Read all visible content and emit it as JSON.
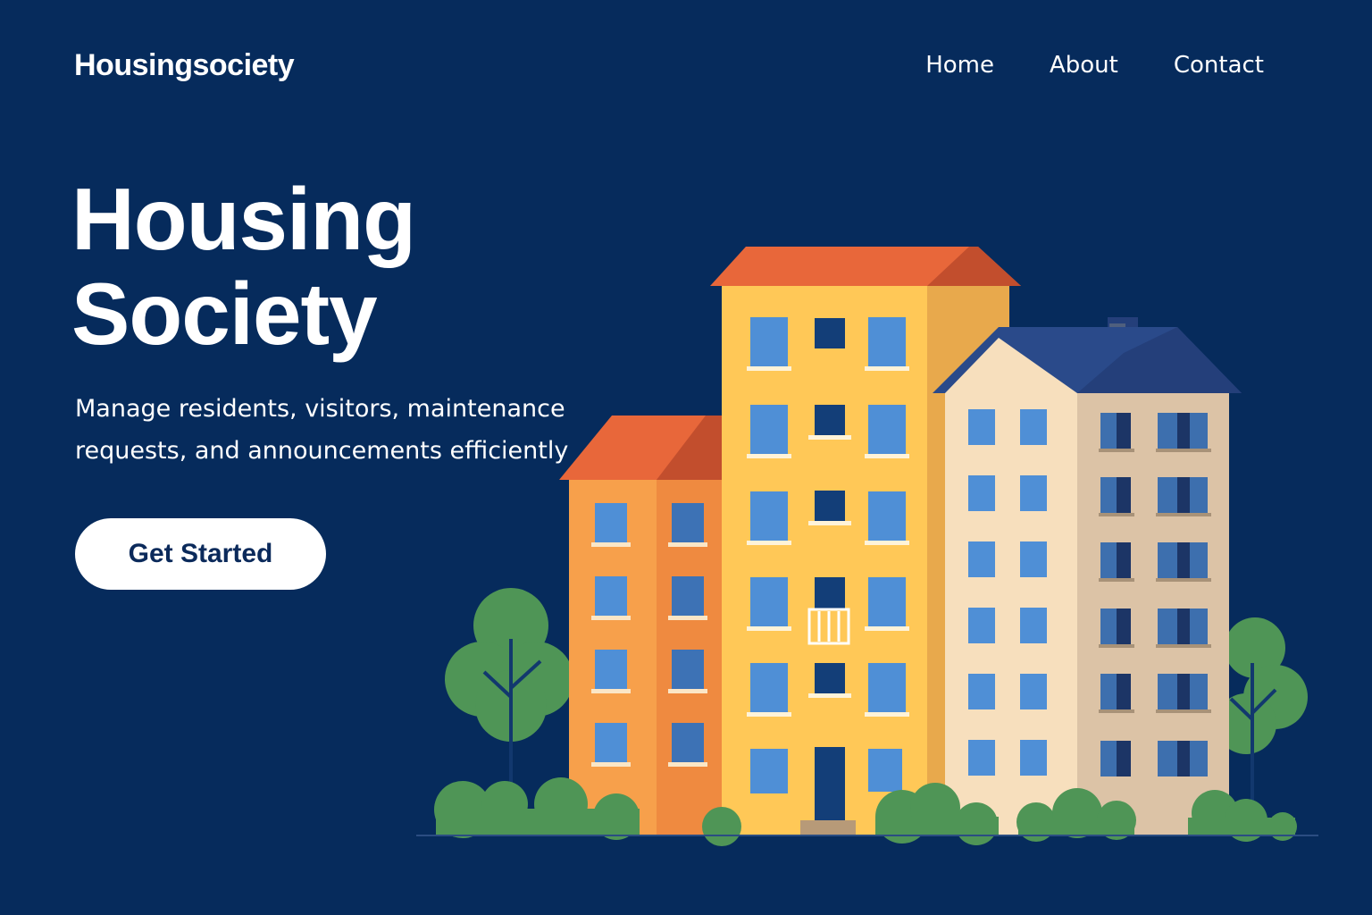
{
  "header": {
    "logo": "Housingsociety",
    "nav": [
      "Home",
      "About",
      "Contact"
    ]
  },
  "hero": {
    "title_line1": "Housing",
    "title_line2": "Society",
    "subtitle_line1": "Manage residents, visitors, maintenance",
    "subtitle_line2": "requests, and announcements efficiently",
    "cta_label": "Get Started"
  },
  "colors": {
    "background": "#062b5c",
    "text": "#ffffff",
    "button_background": "#ffffff",
    "button_text": "#0b2a5b",
    "roof_orange": "#e8673a",
    "building_yellow": "#ffc857",
    "building_orange": "#f7a04b",
    "building_cream": "#f7dfbd",
    "roof_navy": "#243f7a",
    "window_blue": "#4f8fd6",
    "tree_green": "#4f9556"
  }
}
